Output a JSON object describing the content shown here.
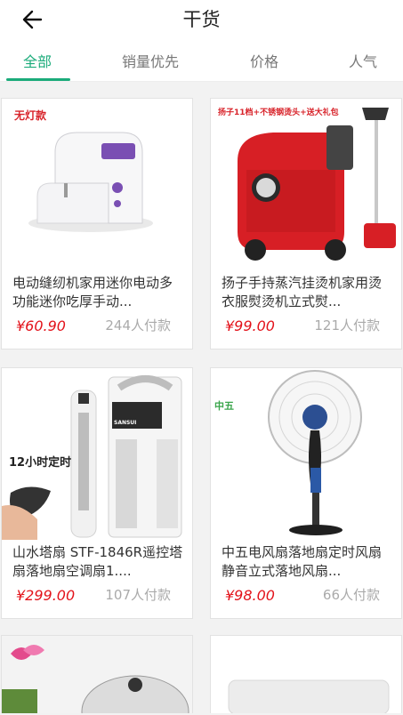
{
  "header": {
    "title": "干货"
  },
  "tabs": [
    {
      "label": "全部",
      "active": true
    },
    {
      "label": "销量优先",
      "active": false
    },
    {
      "label": "价格",
      "active": false
    },
    {
      "label": "人气",
      "active": false
    }
  ],
  "products": [
    {
      "name": "电动缝纫机家用迷你电动多功能迷你吃厚手动...",
      "price": "¥60.90",
      "sales": "244人付款",
      "badge": "无灯款"
    },
    {
      "name": "扬子手持蒸汽挂烫机家用烫衣服熨烫机立式熨...",
      "price": "¥99.00",
      "sales": "121人付款",
      "badge": "扬子11档+不锈钢烫头+送大礼包"
    },
    {
      "name": "山水塔扇 STF-1846R遥控塔扇落地扇空调扇1....",
      "price": "¥299.00",
      "sales": "107人付款",
      "badge": "12小时定时",
      "badge_brand": "SANSUI"
    },
    {
      "name": "中五电风扇落地扇定时风扇静音立式落地风扇...",
      "price": "¥98.00",
      "sales": "66人付款",
      "badge": "中五"
    },
    {
      "name": "",
      "price": "",
      "sales": ""
    },
    {
      "name": "",
      "price": "",
      "sales": ""
    }
  ],
  "colors": {
    "accent": "#1aab7a",
    "price": "#e3131b"
  },
  "icons": {
    "back": "arrow-left-icon"
  }
}
